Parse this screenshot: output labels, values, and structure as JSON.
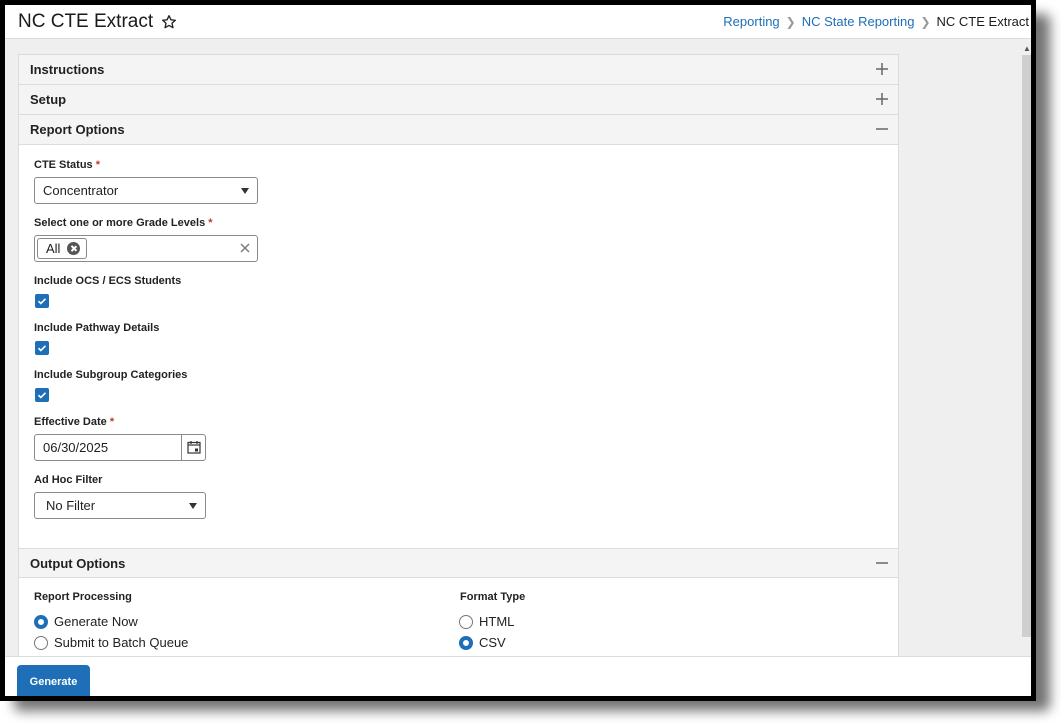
{
  "header": {
    "title": "NC CTE Extract",
    "favorite_icon": "star-outline-icon",
    "breadcrumb": [
      {
        "label": "Reporting",
        "link": true
      },
      {
        "label": "NC State Reporting",
        "link": true
      },
      {
        "label": "NC CTE Extract",
        "link": false
      }
    ],
    "breadcrumb_separator": ">"
  },
  "sections": {
    "instructions": {
      "title": "Instructions",
      "state": "collapsed"
    },
    "setup": {
      "title": "Setup",
      "state": "collapsed"
    },
    "report_options": {
      "title": "Report Options",
      "state": "expanded"
    },
    "output_options": {
      "title": "Output Options",
      "state": "expanded"
    }
  },
  "report_options": {
    "cte_status": {
      "label": "CTE Status",
      "required_mark": "*",
      "value": "Concentrator"
    },
    "grade_levels": {
      "label": "Select one or more Grade Levels",
      "required_mark": "*",
      "chips": [
        "All"
      ]
    },
    "include_ocs": {
      "label": "Include OCS / ECS Students",
      "checked": true
    },
    "include_pathway": {
      "label": "Include Pathway Details",
      "checked": true
    },
    "include_subgroup": {
      "label": "Include Subgroup Categories",
      "checked": true
    },
    "effective_date": {
      "label": "Effective Date",
      "required_mark": "*",
      "value": "06/30/2025"
    },
    "ad_hoc_filter": {
      "label": "Ad Hoc Filter",
      "value": "No Filter"
    }
  },
  "output_options": {
    "report_processing": {
      "label": "Report Processing",
      "options": [
        {
          "label": "Generate Now",
          "selected": true
        },
        {
          "label": "Submit to Batch Queue",
          "selected": false
        }
      ]
    },
    "format_type": {
      "label": "Format Type",
      "options": [
        {
          "label": "HTML",
          "selected": false
        },
        {
          "label": "CSV",
          "selected": true
        }
      ]
    }
  },
  "footer": {
    "generate_label": "Generate"
  },
  "colors": {
    "accent": "#1e6fb8",
    "required": "#c0392b",
    "header_bg": "#f4f4f4",
    "page_bg": "#efefef"
  }
}
